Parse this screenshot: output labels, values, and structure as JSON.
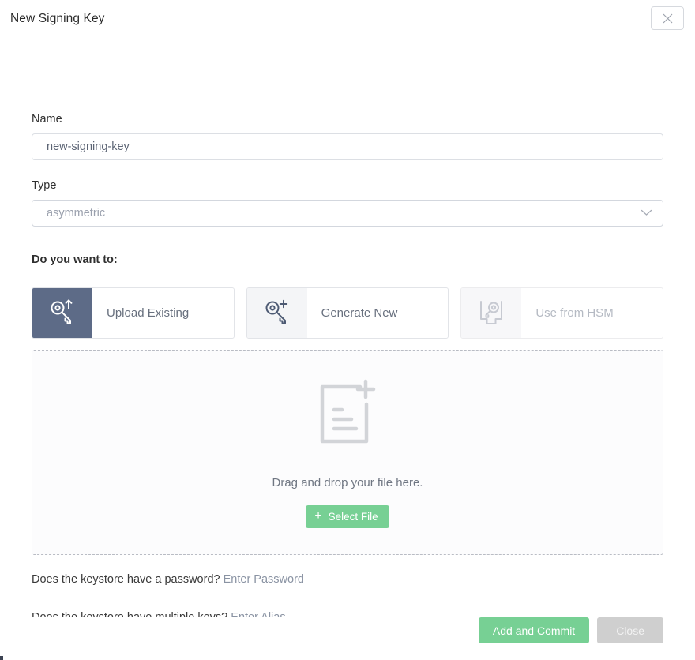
{
  "header": {
    "title": "New Signing Key",
    "close_icon": "close-icon"
  },
  "form": {
    "name": {
      "label": "Name",
      "value": "new-signing-key",
      "placeholder": "new-signing-key"
    },
    "type": {
      "label": "Type",
      "value": "asymmetric",
      "chevron_icon": "chevron-down-icon",
      "options": [
        "asymmetric"
      ]
    },
    "question": "Do you want to:",
    "options": [
      {
        "label": "Upload Existing",
        "icon": "key-upload-icon",
        "selected": true,
        "disabled": false
      },
      {
        "label": "Generate New",
        "icon": "key-plus-icon",
        "selected": false,
        "disabled": false
      },
      {
        "label": "Use from HSM",
        "icon": "hsm-key-icon",
        "selected": false,
        "disabled": true
      }
    ]
  },
  "dropzone": {
    "icon": "file-add-icon",
    "text": "Drag and drop your file here.",
    "select_button": {
      "label": "Select File",
      "icon": "plus-icon"
    }
  },
  "helpers": [
    {
      "question": "Does the keystore have a password?",
      "link": "Enter Password"
    },
    {
      "question": "Does the keystore have multiple keys?",
      "link": "Enter Alias"
    }
  ],
  "footer": {
    "primary_label": "Add and Commit",
    "secondary_label": "Close"
  },
  "colors": {
    "accent_green": "#77d094",
    "selected_slate": "#5d6b87",
    "muted_text": "#9aa0ad",
    "link_text": "#8a93a3",
    "disabled_gray": "#cfcfcf"
  }
}
